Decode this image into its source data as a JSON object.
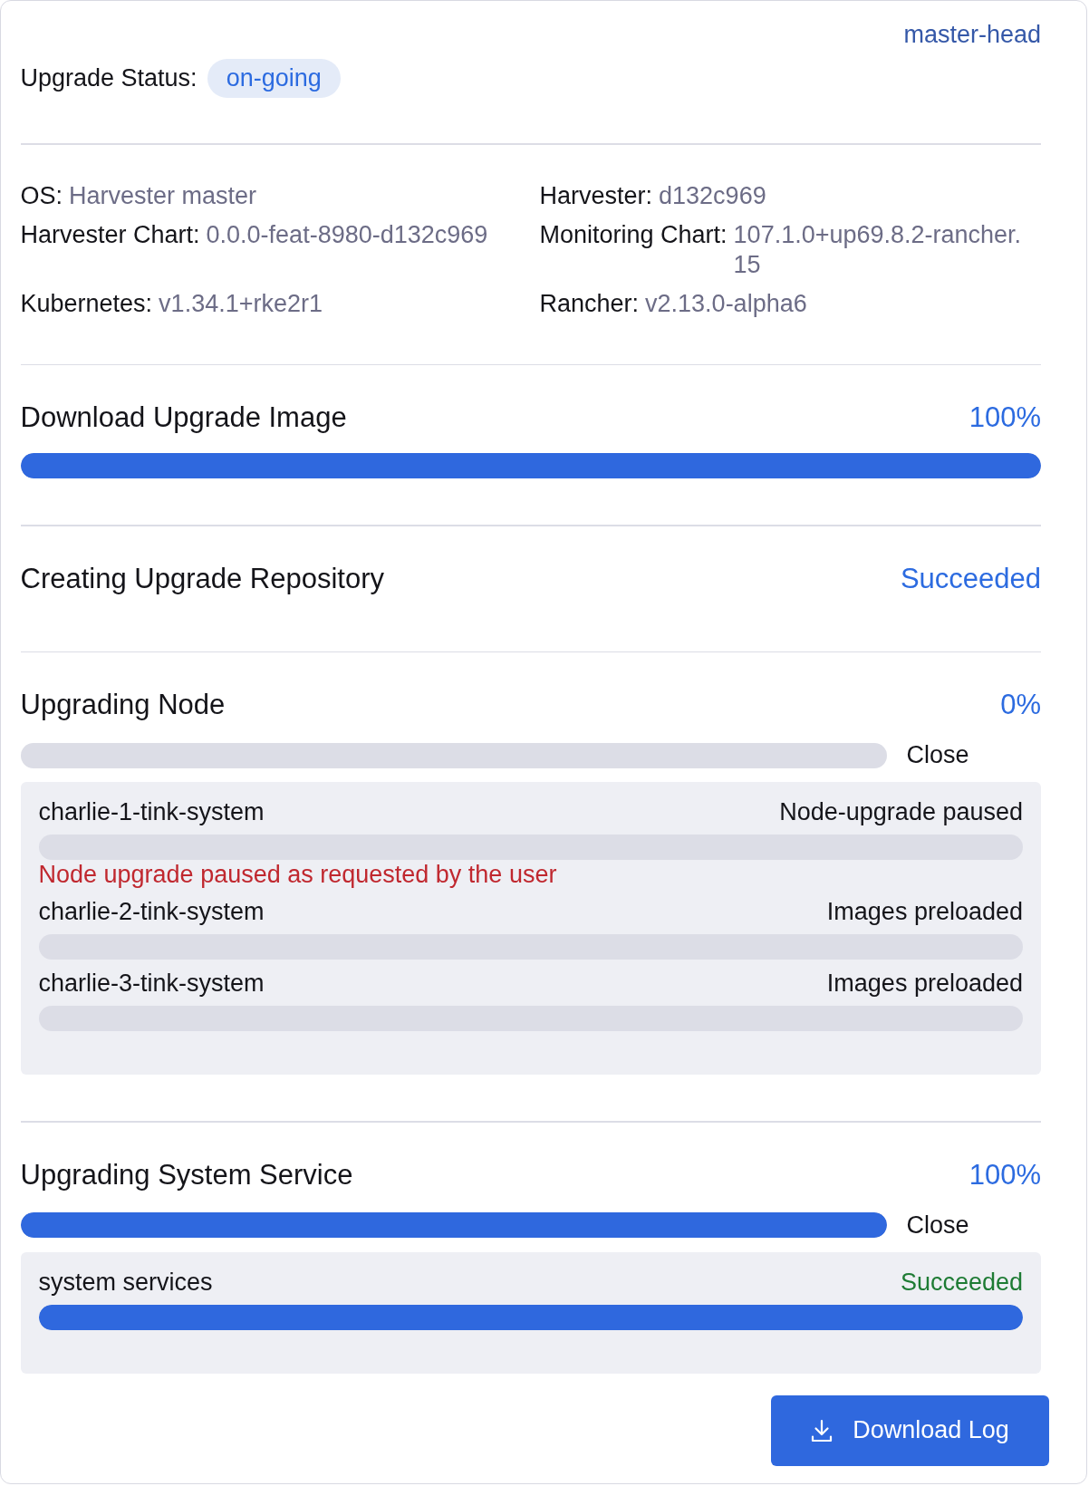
{
  "version_link": "master-head",
  "upgrade_status": {
    "label": "Upgrade Status:",
    "value": "on-going"
  },
  "versions": [
    {
      "label": "OS:",
      "value": "Harvester master"
    },
    {
      "label": "Harvester:",
      "value": "d132c969"
    },
    {
      "label": "Harvester Chart:",
      "value": "0.0.0-feat-8980-d132c969"
    },
    {
      "label": "Monitoring Chart:",
      "value": "107.1.0+up69.8.2-rancher.15"
    },
    {
      "label": "Kubernetes:",
      "value": "v1.34.1+rke2r1"
    },
    {
      "label": "Rancher:",
      "value": "v2.13.0-alpha6"
    }
  ],
  "steps": [
    {
      "kind": "progress",
      "title": "Download Upgrade Image",
      "status": "100%",
      "level": 1
    },
    {
      "kind": "status",
      "title": "Creating Upgrade Repository",
      "status": "Succeeded"
    },
    {
      "kind": "progress",
      "title": "Upgrading Node",
      "status": "0%",
      "level": 0,
      "toggle": "Close",
      "expanded": true,
      "details": [
        {
          "name": "charlie-1-tink-system",
          "status": "Node-upgrade paused",
          "success": false,
          "level": 0,
          "message": "Node upgrade paused as requested by the user"
        },
        {
          "name": "charlie-2-tink-system",
          "status": "Images preloaded",
          "success": false,
          "level": 0
        },
        {
          "name": "charlie-3-tink-system",
          "status": "Images preloaded",
          "success": false,
          "level": 0
        }
      ]
    },
    {
      "kind": "progress",
      "title": "Upgrading System Service",
      "status": "100%",
      "level": 1,
      "toggle": "Close",
      "expanded": true,
      "details": [
        {
          "name": "system services",
          "status": "Succeeded",
          "success": true,
          "level": 1
        }
      ]
    }
  ],
  "download_button": "Download Log"
}
